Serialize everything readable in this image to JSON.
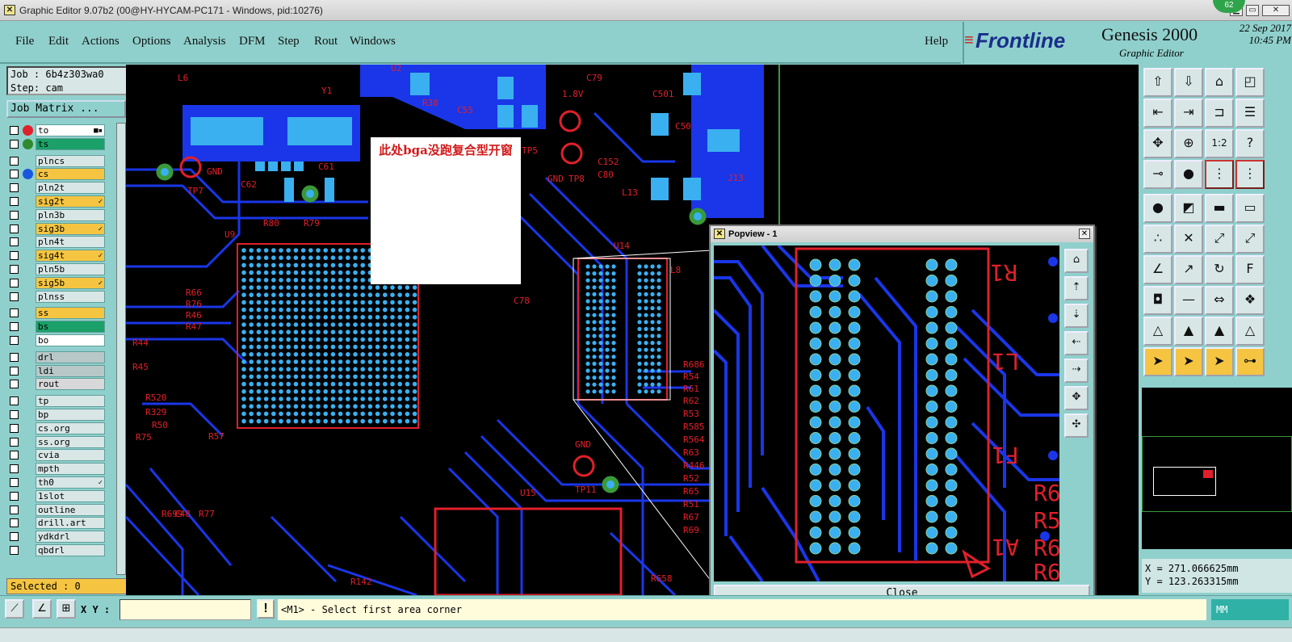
{
  "window": {
    "title": "Graphic Editor 9.07b2 (00@HY-HYCAM-PC171 - Windows, pid:10276)",
    "badge": "62"
  },
  "menu": {
    "items": [
      "File",
      "Edit",
      "Actions",
      "Options",
      "Analysis",
      "DFM",
      "Step",
      "Rout",
      "Windows"
    ],
    "help": "Help"
  },
  "brand": {
    "logo": "Frontline",
    "product": "Genesis 2000",
    "subtitle": "Graphic Editor",
    "date": "22 Sep 2017",
    "time": "10:45 PM"
  },
  "job": {
    "job_line": "Job : 6b4z303wa0",
    "step_line": "Step: cam",
    "matrix_btn": "Job Matrix ..."
  },
  "layers": [
    {
      "name": "to",
      "color": "#ffffff",
      "dot": "#e0202a",
      "flag": "■▪"
    },
    {
      "name": "ts",
      "color": "#1aa068",
      "dot": "#2f8a2f",
      "flag": ""
    },
    {
      "name": "plncs",
      "color": "#d8e6e6",
      "dot": "",
      "flag": ""
    },
    {
      "name": "cs",
      "color": "#f5c542",
      "dot": "#1a55e0",
      "flag": ""
    },
    {
      "name": "pln2t",
      "color": "#d8e6e6",
      "dot": "",
      "flag": ""
    },
    {
      "name": "sig2t",
      "color": "#f5c542",
      "dot": "",
      "flag": "✓"
    },
    {
      "name": "pln3b",
      "color": "#d8e6e6",
      "dot": "",
      "flag": ""
    },
    {
      "name": "sig3b",
      "color": "#f5c542",
      "dot": "",
      "flag": "✓"
    },
    {
      "name": "pln4t",
      "color": "#d8e6e6",
      "dot": "",
      "flag": ""
    },
    {
      "name": "sig4t",
      "color": "#f5c542",
      "dot": "",
      "flag": "✓"
    },
    {
      "name": "pln5b",
      "color": "#d8e6e6",
      "dot": "",
      "flag": ""
    },
    {
      "name": "sig5b",
      "color": "#f5c542",
      "dot": "",
      "flag": "✓"
    },
    {
      "name": "plnss",
      "color": "#d8e6e6",
      "dot": "",
      "flag": ""
    },
    {
      "name": "ss",
      "color": "#f5c542",
      "dot": "",
      "flag": ""
    },
    {
      "name": "bs",
      "color": "#1aa068",
      "dot": "",
      "flag": ""
    },
    {
      "name": "bo",
      "color": "#ffffff",
      "dot": "",
      "flag": ""
    },
    {
      "name": "drl",
      "color": "#b8c8c8",
      "dot": "",
      "flag": ""
    },
    {
      "name": "ldi",
      "color": "#b8c8c8",
      "dot": "",
      "flag": ""
    },
    {
      "name": "rout",
      "color": "#d8d8d8",
      "dot": "",
      "flag": ""
    },
    {
      "name": "tp",
      "color": "#d8e6e6",
      "dot": "",
      "flag": ""
    },
    {
      "name": "bp",
      "color": "#d8e6e6",
      "dot": "",
      "flag": ""
    },
    {
      "name": "cs.org",
      "color": "#d8e6e6",
      "dot": "",
      "flag": ""
    },
    {
      "name": "ss.org",
      "color": "#d8e6e6",
      "dot": "",
      "flag": ""
    },
    {
      "name": "cvia",
      "color": "#d8e6e6",
      "dot": "",
      "flag": ""
    },
    {
      "name": "mpth",
      "color": "#d8e6e6",
      "dot": "",
      "flag": ""
    },
    {
      "name": "th0",
      "color": "#d8e6e6",
      "dot": "",
      "flag": "✓"
    },
    {
      "name": "1slot",
      "color": "#d8e6e6",
      "dot": "",
      "flag": ""
    },
    {
      "name": "outline",
      "color": "#d8e6e6",
      "dot": "",
      "flag": ""
    },
    {
      "name": "drill.art",
      "color": "#d8e6e6",
      "dot": "",
      "flag": ""
    },
    {
      "name": "ydkdrl",
      "color": "#d8e6e6",
      "dot": "",
      "flag": ""
    },
    {
      "name": "qbdrl",
      "color": "#d8e6e6",
      "dot": "",
      "flag": ""
    }
  ],
  "selected": "Selected : 0",
  "note": "此处bga没跑复合型开窗",
  "board_labels": [
    "GND",
    "TP7",
    "Y1",
    "C61",
    "C62",
    "R79",
    "R80",
    "U9",
    "R66",
    "R76",
    "R46",
    "R47",
    "R44",
    "R45",
    "R520",
    "R329",
    "R50",
    "R75",
    "R57",
    "C48",
    "R77",
    "R699",
    "C78",
    "U14",
    "C79",
    "C55",
    "R38",
    "TP5",
    "TP8",
    "GND",
    "C152",
    "C80",
    "L13",
    "J13",
    "C50",
    "C501",
    "R686",
    "R54",
    "R61",
    "R62",
    "R53",
    "R585",
    "R564",
    "R63",
    "R446",
    "R52",
    "R65",
    "R51",
    "R67",
    "R69",
    "GND",
    "TP11",
    "U15",
    "R142",
    "R658",
    "U2",
    "L6",
    "L8",
    "1.8V"
  ],
  "popview": {
    "title": "Popview - 1",
    "close": "Close",
    "labels": [
      "R1",
      "L1",
      "F1",
      "A1",
      "R6",
      "R5",
      "R6",
      "R6"
    ]
  },
  "statusbar": {
    "xy_label": "X Y :",
    "warn": "!",
    "message": "<M1> - Select first area corner",
    "units": "MM"
  },
  "coords": {
    "x": "X = 271.066625mm",
    "y": "Y = 123.263315mm"
  }
}
